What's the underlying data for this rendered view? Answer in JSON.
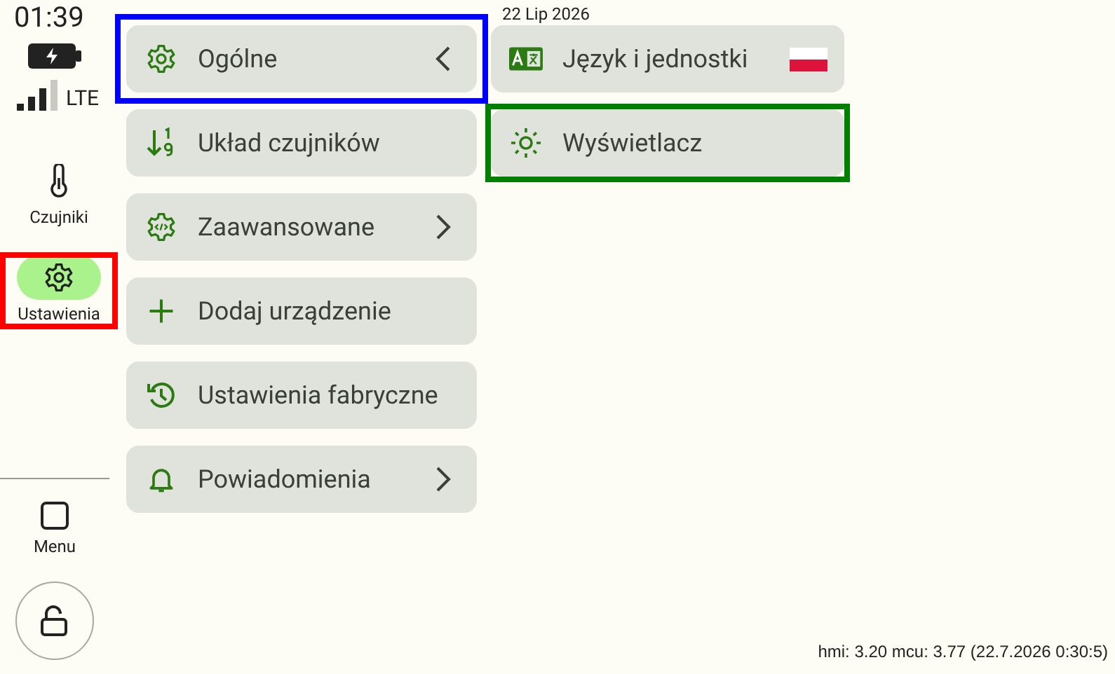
{
  "status": {
    "time": "01:39",
    "network": "LTE"
  },
  "nav": [
    {
      "label": "Czujniki",
      "selected": false
    },
    {
      "label": "Ustawienia",
      "selected": true,
      "color": "#ff0000"
    }
  ],
  "menu_button": {
    "label": "Menu"
  },
  "menu": [
    {
      "label": "Ogólne",
      "kind": "back",
      "color": "#0000ff"
    },
    {
      "label": "Układ czujników",
      "kind": "plain"
    },
    {
      "label": "Zaawansowane",
      "kind": "submenu"
    },
    {
      "label": "Dodaj urządzenie",
      "kind": "plain"
    },
    {
      "label": "Ustawienia fabryczne",
      "kind": "plain"
    },
    {
      "label": "Powiadomienia",
      "kind": "submenu"
    }
  ],
  "date": "22 Lip 2026",
  "submenu": [
    {
      "label": "Język i jednostki",
      "kind": "language"
    },
    {
      "label": "Wyświetlacz",
      "kind": "plain",
      "color": "#008000"
    }
  ],
  "footer": "hmi: 3.20 mcu: 3.77 (22.7.2026 0:30:5)"
}
